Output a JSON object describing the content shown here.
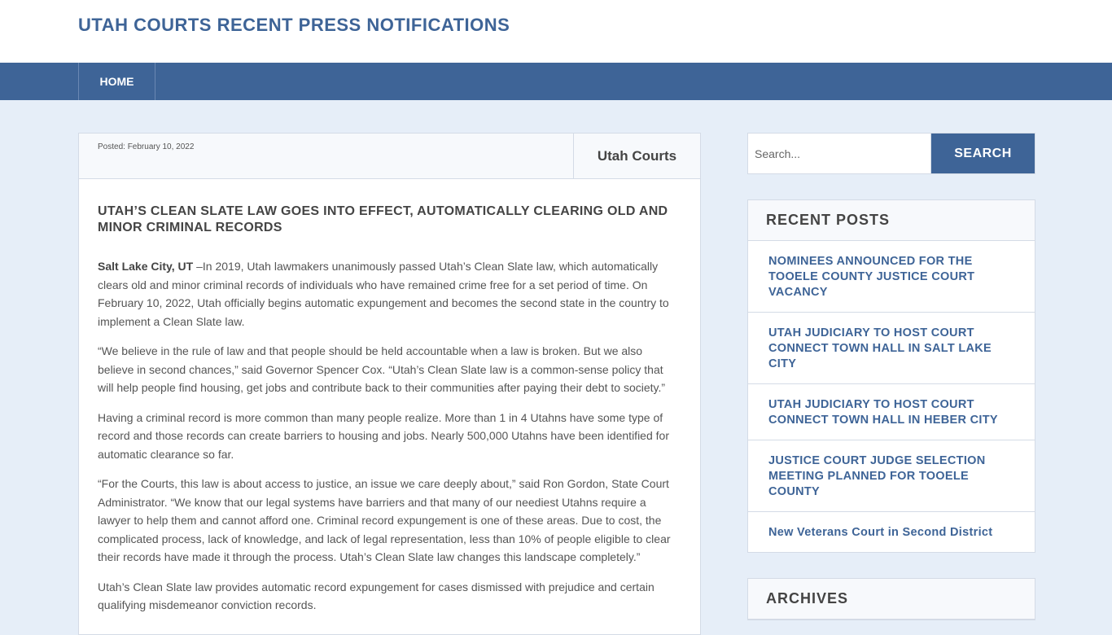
{
  "header": {
    "site_title": "UTAH COURTS RECENT PRESS NOTIFICATIONS"
  },
  "nav": {
    "home_label": "HOME"
  },
  "post": {
    "posted": "Posted: February 10, 2022",
    "author": "Utah Courts",
    "title": "UTAH’S CLEAN SLATE LAW GOES INTO EFFECT, AUTOMATICALLY CLEARING OLD AND MINOR CRIMINAL RECORDS",
    "dateline": "Salt Lake City, UT",
    "p1_rest": " –In 2019, Utah lawmakers unanimously passed Utah’s Clean Slate law, which automatically clears old and minor criminal records of individuals who have remained crime free for a set period of time. On February 10, 2022, Utah officially begins automatic expungement and becomes the second state in the country to implement a Clean Slate law.",
    "p2": "“We believe in the rule of law and that people should be held accountable when a law is broken. But we also believe in second chances,” said Governor Spencer Cox. “Utah’s Clean Slate law is a common-sense policy that will help people find housing, get jobs and contribute back to their communities after paying their debt to society.”",
    "p3": "Having a criminal record is more common than many people realize. More than 1 in 4 Utahns have some type of record and those records can create barriers to housing and jobs. Nearly 500,000 Utahns have been identified for automatic clearance so far.",
    "p4": "“For the Courts, this law is about access to justice, an issue we care deeply about,” said Ron Gordon, State Court Administrator. “We know that our legal systems have barriers and that many of our neediest Utahns require a lawyer to help them and cannot afford one. Criminal record expungement is one of these areas. Due to cost, the complicated process, lack of knowledge, and lack of legal representation, less than 10% of people eligible to clear their records have made it through the process. Utah’s Clean Slate law changes this landscape completely.”",
    "p5": "Utah’s Clean Slate law provides automatic record expungement for cases dismissed with prejudice and certain qualifying misdemeanor conviction records."
  },
  "sidebar": {
    "search": {
      "placeholder": "Search...",
      "button_label": "SEARCH"
    },
    "recent_posts": {
      "title": "RECENT POSTS",
      "items": [
        "NOMINEES ANNOUNCED FOR THE TOOELE COUNTY JUSTICE COURT VACANCY",
        "UTAH JUDICIARY TO HOST COURT CONNECT TOWN HALL IN SALT LAKE CITY",
        "UTAH JUDICIARY TO HOST COURT CONNECT TOWN HALL IN HEBER CITY",
        "JUSTICE COURT JUDGE SELECTION MEETING PLANNED FOR TOOELE COUNTY",
        "New Veterans Court in Second District"
      ]
    },
    "archives": {
      "title": "ARCHIVES"
    }
  }
}
